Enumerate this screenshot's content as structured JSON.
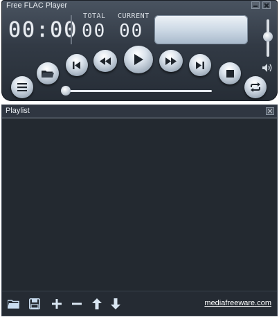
{
  "player": {
    "title": "Free FLAC Player",
    "time_display": "00:00",
    "total_label": "TOTAL",
    "total_value": "00",
    "current_label": "CURRENT",
    "current_value": "00",
    "volume_level": 0.55,
    "seek_position": 0.0
  },
  "playlist": {
    "title": "Playlist",
    "items": [],
    "footer_link": "mediafreeware.com"
  },
  "colors": {
    "accent": "#c9d6e3",
    "background": "#2a3039"
  }
}
